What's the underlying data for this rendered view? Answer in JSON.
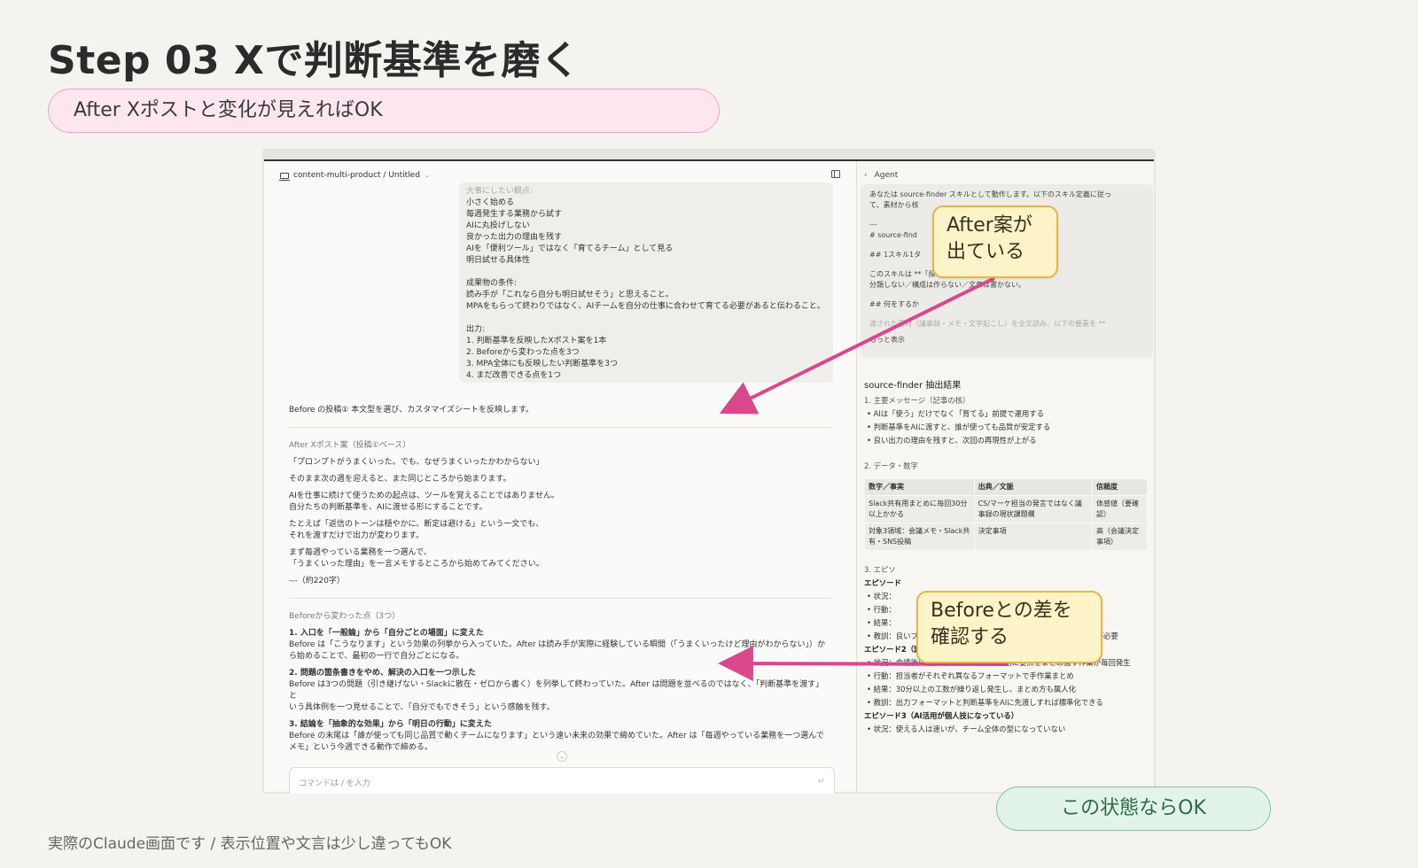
{
  "slide": {
    "title": "Step 03  Xで判断基準を磨く",
    "subtitle": "After Xポストと変化が見えればOK",
    "footer": "実際のClaude画面です / 表示位置や文言は少し違ってもOK",
    "ok_label": "この状態ならOK"
  },
  "annotations": {
    "after_callout": [
      "After案が",
      "出ている"
    ],
    "before_callout": [
      "Beforeとの差を",
      "確認する"
    ]
  },
  "colors": {
    "accent_pink": "#d9478c",
    "callout_border": "#e9b544",
    "ok_green": "#7cc49a"
  },
  "chat": {
    "breadcrumb": "content-multi-product / Untitled",
    "prompt_faded": "大事にしたい観点:",
    "prompt_lines": [
      "小さく始める",
      "毎週発生する業務から試す",
      "AIに丸投げしない",
      "良かった出力の理由を残す",
      "AIを「便利ツール」ではなく「育てるチーム」として見る",
      "明日試せる具体性"
    ],
    "prompt_cond_head": "成果物の条件:",
    "prompt_cond": [
      "読み手が「これなら自分も明日試せそう」と思えること。",
      "MPAをもらって終わりではなく、AIチームを自分の仕事に合わせて育てる必要があると伝わること。"
    ],
    "prompt_out_head": "出力:",
    "prompt_out": [
      "1. 判断基準を反映したXポスト案を1本",
      "2. Beforeから変わった点を3つ",
      "3. MPA全体にも反映したい判断基準を3つ",
      "4. まだ改善できる点を1つ"
    ],
    "reply_intro": "Before の投稿① 本文型を選び、カスタマイズシートを反映します。",
    "after_head": "After Xポスト案（投稿①ベース）",
    "after_paras": [
      [
        "「プロンプトがうまくいった。でも、なぜうまくいったかわからない」"
      ],
      [
        "そのまま次の週を迎えると、また同じところから始まります。"
      ],
      [
        "AIを仕事に続けて使うための起点は、ツールを覚えることではありません。",
        "自分たちの判断基準を、AIに渡せる形にすることです。"
      ],
      [
        "たとえば「返信のトーンは穏やかに、断定は避ける」という一文でも、",
        "それを渡すだけで出力が変わります。"
      ],
      [
        "まず毎週やっている業務を一つ選んで、",
        "「うまくいった理由」を一言メモするところから始めてみてください。"
      ],
      [
        "---（約220字）"
      ]
    ],
    "changes_head": "Beforeから変わった点（3つ）",
    "changes": [
      {
        "title": "1. 入口を「一般論」から「自分ごとの場面」に変えた",
        "body": [
          "Before は「こうなります」という効果の列挙から入っていた。After は読み手が実際に経験している瞬間（「うまくいったけど理由がわからない」）か",
          "ら始めることで、最初の一行で自分ごとになる。"
        ]
      },
      {
        "title": "2. 問題の箇条書きをやめ、解決の入口を一つ示した",
        "body": [
          "Before は3つの問題（引き継げない・Slackに散在・ゼロから書く）を列挙して終わっていた。After は問題を並べるのではなく、「判断基準を渡す」と",
          "いう具体例を一つ見せることで、「自分でもできそう」という感触を残す。"
        ]
      },
      {
        "title": "3. 結論を「抽象的な効果」から「明日の行動」に変えた",
        "body": [
          "Before の末尾は「誰が使っても同じ品質で動くチームになります」という遠い未来の効果で締めていた。After は「毎週やっている業務を一つ選んで",
          "メモ」という今週できる動作で締める。"
        ]
      }
    ],
    "input_placeholder": "コマンドは / を入力"
  },
  "agent": {
    "header": "Agent",
    "prompt_lines": [
      "あなたは source-finder スキルとして動作します。以下のスキル定義に従っ",
      "て、素材から核"
    ],
    "prompt_mid": [
      "---",
      "# source-find",
      "",
      "## 1スキル1タ",
      "",
      "このスキルは **「探す」だけを担当する。",
      "分類しない／構成は作らない／文章は書かない。",
      "",
      "## 何をするか"
    ],
    "prompt_faint": "渡された素材（議事録・メモ・文字起こし）を全文読み、以下の要素を **",
    "show_more": "もっと表示",
    "result_title": "source-finder 抽出結果",
    "sec1": "1. 主要メッセージ（記事の核）",
    "sec1_items": [
      "AIは「使う」だけでなく「育てる」前提で運用する",
      "判断基準をAIに渡すと、誰が使っても品質が安定する",
      "良い出力の理由を残すと、次回の再現性が上がる"
    ],
    "sec2": "2. データ・数字",
    "table_head": [
      "数字／事実",
      "出典／文脈",
      "信頼度"
    ],
    "table_rows": [
      [
        "Slack共有用まとめに毎回30分以上かかる",
        "CS/マーケ担当の発言ではなく議事録の現状課題欄",
        "体感値（要確認）"
      ],
      [
        "対象3領域：会議メモ・Slack共有・SNS投稿",
        "決定事項",
        "高（会議決定事項）"
      ]
    ],
    "sec3": "3. エピソ",
    "ep1": "エピソード",
    "ep1_items": [
      "状況：",
      "行動：",
      "結果："
    ],
    "ep1_lesson": "教訓：良いプロンプトは「なぜ良かったか」とセットで残す仕組みが必要",
    "ep2": "エピソード2（議事録はあるが次の行動が見えない）",
    "ep2_items": [
      "状況：会議後に議事録は残るが、Slack用に要点をまとめ直す作業が毎回発生",
      "行動：担当者がそれぞれ異なるフォーマットで手作業まとめ",
      "結果：30分以上の工数が繰り返し発生し、まとめ方も属人化",
      "教訓：出力フォーマットと判断基準をAIに先渡しすれば標準化できる"
    ],
    "ep3": "エピソード3（AI活用が個人技になっている）",
    "ep3_items": [
      "状況：使える人は速いが、チーム全体の型になっていない"
    ]
  }
}
